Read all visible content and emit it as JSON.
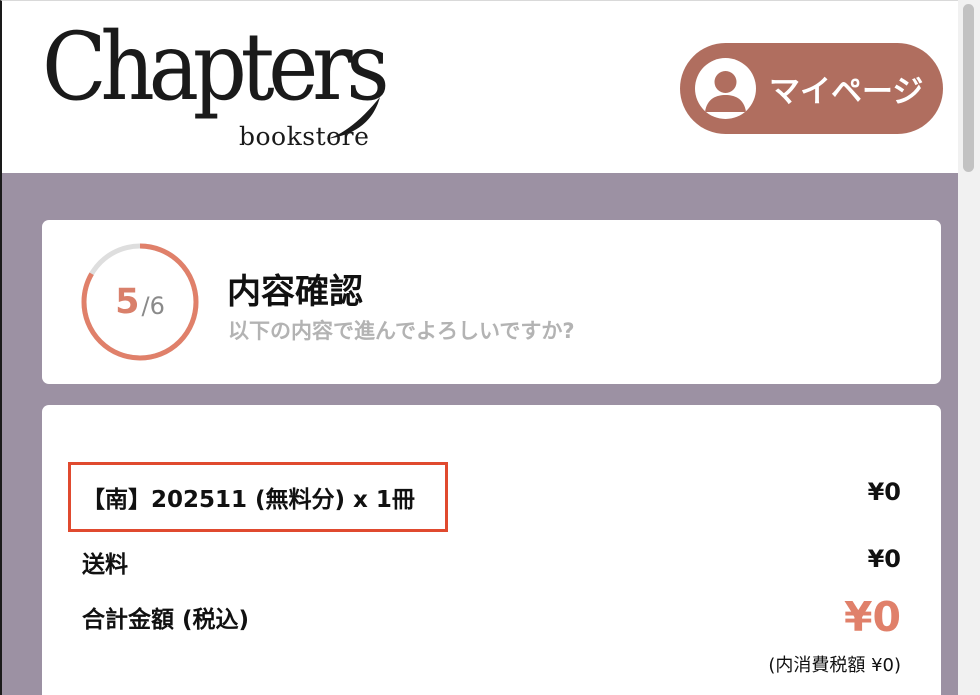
{
  "header": {
    "logo_main": "Chapters",
    "logo_sub": "bookstore",
    "mypage_label": "マイページ"
  },
  "progress": {
    "current": "5",
    "total": "/6",
    "fraction": 0.8333
  },
  "step": {
    "title": "内容確認",
    "subtitle": "以下の内容で進んでよろしいですか?"
  },
  "order": {
    "item_label": "【南】202511 (無料分) x 1冊",
    "item_price": "¥0",
    "shipping_label": "送料",
    "shipping_price": "¥0",
    "total_label": "合計金額 (税込)",
    "total_price": "¥0",
    "tax_note": "(内消費税額 ¥0)"
  },
  "colors": {
    "accent": "#b06e5f",
    "progress": "#e0806a",
    "background": "#9c91a3",
    "highlight_border": "#e04a2f"
  }
}
